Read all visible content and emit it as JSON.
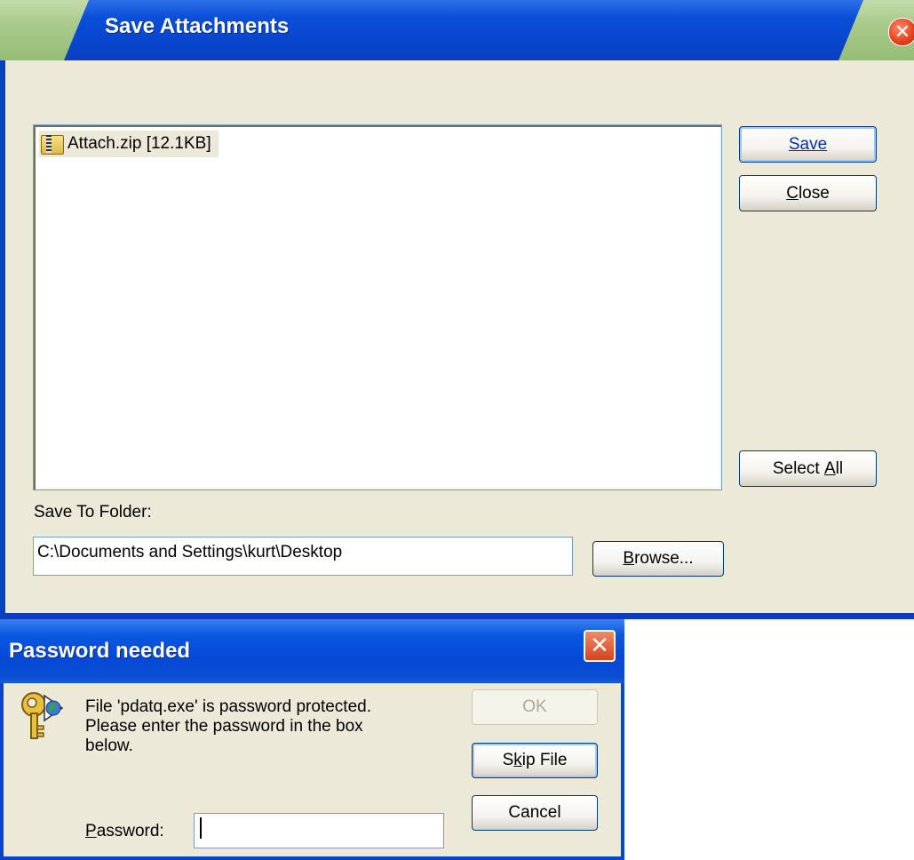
{
  "save_attachments": {
    "title": "Save Attachments",
    "files": [
      {
        "label": "Attach.zip [12.1KB]",
        "icon": "zip-folder-icon"
      }
    ],
    "buttons": {
      "save": "Save",
      "close": "Close",
      "select_all_prefix": "Select ",
      "select_all_access": "A",
      "select_all_suffix": "ll",
      "close_access": "C",
      "close_rest": "lose",
      "browse_access": "B",
      "browse_rest": "rowse..."
    },
    "folder_label": "Save To Folder:",
    "folder_value": "C:\\Documents and Settings\\kurt\\Desktop"
  },
  "password_dialog": {
    "title": "Password needed",
    "message": "File 'pdatq.exe' is password protected.\nPlease enter the password in the box\nbelow.",
    "buttons": {
      "ok": "OK",
      "skip_prefix": "S",
      "skip_access": "k",
      "skip_suffix": "ip File",
      "cancel": "Cancel"
    },
    "password_label_access": "P",
    "password_label_rest": "assword:",
    "password_value": ""
  },
  "colors": {
    "xp_blue": "#0846cc",
    "window_bg": "#ece9d8",
    "close_red": "#e4411c"
  }
}
